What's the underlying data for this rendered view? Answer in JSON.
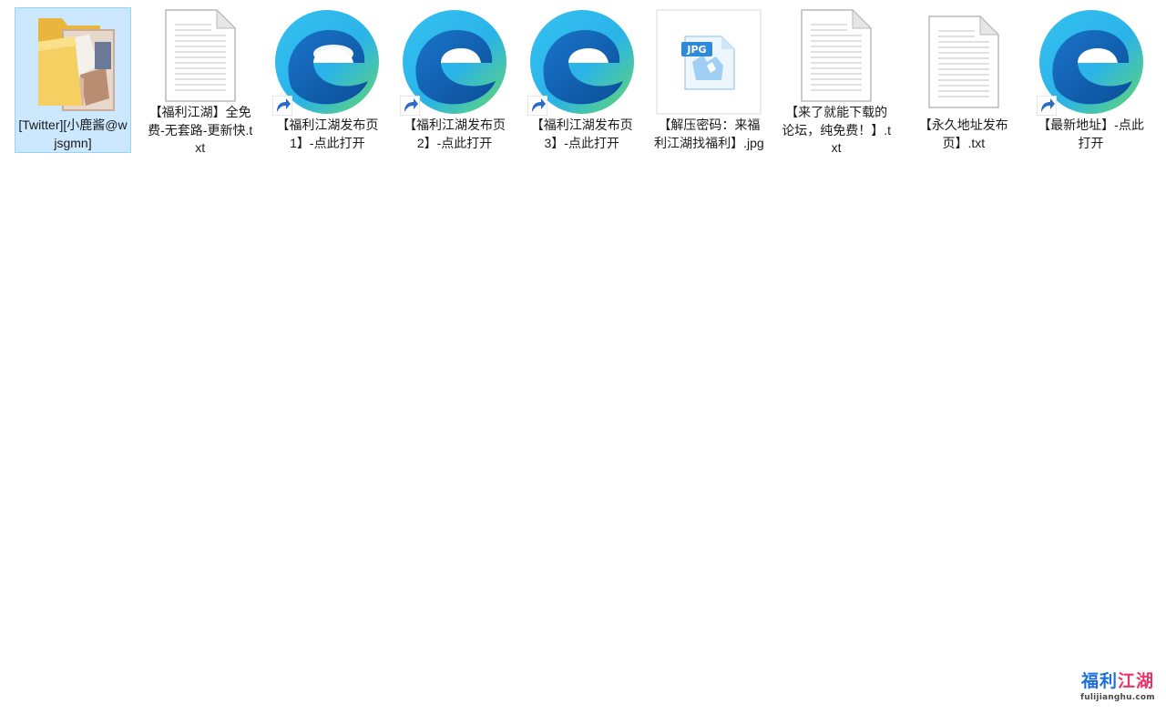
{
  "files": [
    {
      "label": "[Twitter][小鹿酱@wjsgmn]",
      "icon": "folder-icon",
      "selected": true
    },
    {
      "label": "【福利江湖】全免费-无套路-更新快.txt",
      "icon": "text-file-icon"
    },
    {
      "label": "【福利江湖发布页1】-点此打开",
      "icon": "edge-shortcut-icon"
    },
    {
      "label": "【福利江湖发布页2】-点此打开",
      "icon": "edge-shortcut-icon"
    },
    {
      "label": "【福利江湖发布页3】-点此打开",
      "icon": "edge-shortcut-icon"
    },
    {
      "label": "【解压密码：来福利江湖找福利】.jpg",
      "icon": "jpg-file-icon",
      "badge": "JPG"
    },
    {
      "label": "【来了就能下载的论坛，纯免费！】.txt",
      "icon": "text-file-icon"
    },
    {
      "label": "【永久地址发布页】.txt",
      "icon": "text-file-icon"
    },
    {
      "label": "【最新地址】-点此打开",
      "icon": "edge-shortcut-icon"
    }
  ],
  "watermark": {
    "title_part1": "福利",
    "title_part2": "江湖",
    "url": "fulijianghu.com"
  },
  "colors": {
    "selection_bg": "#cce8ff",
    "selection_border": "#99d1ff",
    "folder_yellow": "#f2c14e",
    "edge_blue": "#0c59a4",
    "edge_green": "#54c96e"
  }
}
